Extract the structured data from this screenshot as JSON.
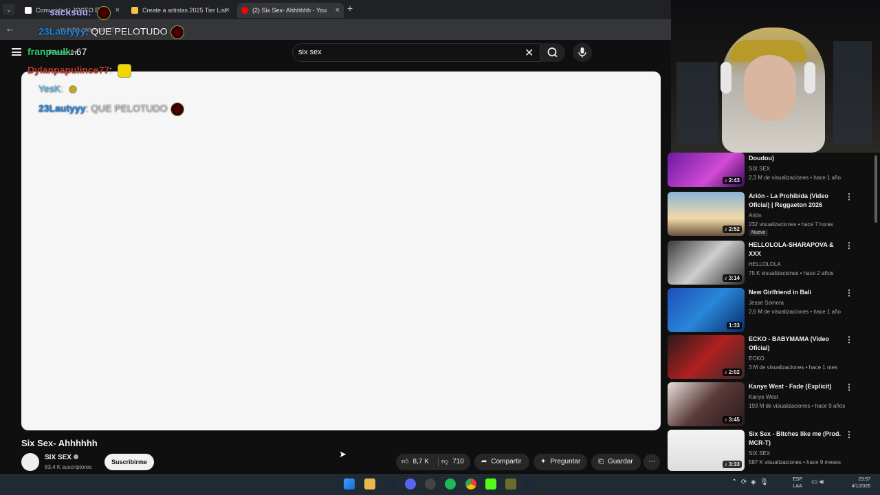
{
  "browser": {
    "tabs": [
      {
        "label": "Comunidad | JOSEO E..."
      },
      {
        "label": "Create a artistas 2025 Tier List"
      },
      {
        "label": "(2) Six Sex- Ahhhhhh - You"
      }
    ],
    "url": "youtube.com/watch?v=..."
  },
  "youtube": {
    "premium_label": "Premium",
    "search_query": "six sex",
    "video": {
      "title": "Six Sex- Ahhhhhh",
      "channel": "SIX SEX",
      "subscribers": "83,4 K suscriptores",
      "subscribe_label": "Suscribirme",
      "likes": "8,7 K",
      "dislikes": "710",
      "share_label": "Compartir",
      "ask_label": "Preguntar",
      "save_label": "Guardar"
    },
    "recommendations": [
      {
        "title": "Doudou)",
        "channel": "SIX SEX",
        "meta": "2,3 M de visualizaciones • hace 1 año",
        "duration": "2:43"
      },
      {
        "title": "Arión - La Prohibida (Video Oficial) | Reggaeton 2026",
        "channel": "Arión",
        "meta": "232 visualizaciones • hace 7 horas",
        "badge": "Nuevo",
        "duration": "2:52"
      },
      {
        "title": "HELLOLOLA-SHARAPOVA & XXX",
        "channel": "HELLOLOLA",
        "meta": "75 K visualizaciones • hace 2 años",
        "duration": "3:14"
      },
      {
        "title": "New Girlfriend in Bali",
        "channel": "Jesse Somera",
        "meta": "2,6 M de visualizaciones • hace 1 año",
        "duration": "1:33"
      },
      {
        "title": "ECKO - BABYMAMA (Video Oficial)",
        "channel": "ECKO",
        "meta": "3 M de visualizaciones • hace 1 mes",
        "duration": "2:02"
      },
      {
        "title": "Kanye West - Fade (Explicit)",
        "channel": "Kanye West",
        "meta": "193 M de visualizaciones • hace 9 años",
        "duration": "3:45"
      },
      {
        "title": "Six Sex - Bitches like me (Prod. MCR-T)",
        "channel": "SIX SEX",
        "meta": "587 K visualizaciones • hace 9 meses",
        "duration": "3:33"
      }
    ]
  },
  "chat": [
    {
      "user": "sacksuu",
      "message": ""
    },
    {
      "user": "23Lautyyy",
      "message": "QUE PELOTUDO"
    },
    {
      "user": "franpaulk",
      "message": "67"
    },
    {
      "user": "Dylanpapulince77",
      "message": ""
    },
    {
      "user": "YesK",
      "message": ""
    },
    {
      "user": "23Lautyyy",
      "message": "QUE PELOTUDO"
    }
  ],
  "taskbar": {
    "language": [
      "ESP",
      "LAA"
    ],
    "time": "23:57",
    "date": "4/1/2026"
  },
  "colors": {
    "youtube_bg": "#0f0f0f",
    "player_bg": "#f6f6f7",
    "pill_bg": "#272727",
    "taskbar_bg": "#1f2a33"
  }
}
